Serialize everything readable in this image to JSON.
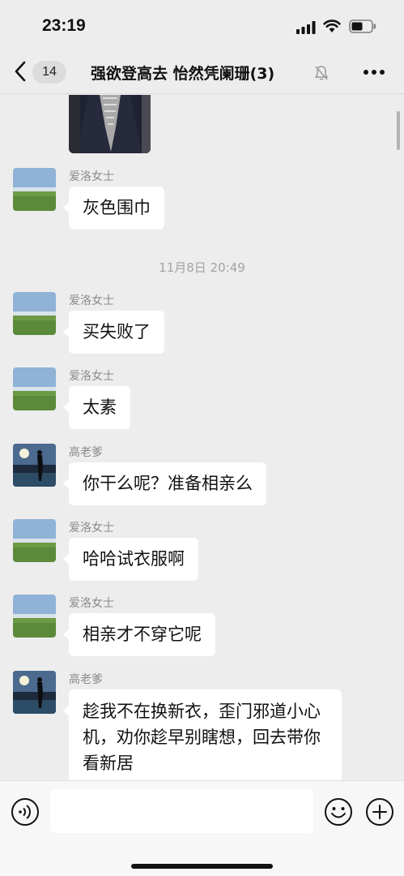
{
  "status_bar": {
    "time": "23:19"
  },
  "nav": {
    "unread_count": "14",
    "title": "强欲登高去 怡然凭阑珊(3)",
    "muted": true
  },
  "chat": {
    "time_divider": "11月8日 20:49",
    "messages": [
      {
        "sender": "爱洛女士",
        "avatar": "landscape-avatar",
        "text": "灰色围巾"
      },
      {
        "sender": "爱洛女士",
        "avatar": "landscape-avatar",
        "text": "买失败了"
      },
      {
        "sender": "爱洛女士",
        "avatar": "landscape-avatar",
        "text": "太素"
      },
      {
        "sender": "高老爹",
        "avatar": "silhouette-avatar",
        "text": "你干么呢？准备相亲么"
      },
      {
        "sender": "爱洛女士",
        "avatar": "landscape-avatar",
        "text": "哈哈试衣服啊"
      },
      {
        "sender": "爱洛女士",
        "avatar": "landscape-avatar",
        "text": "相亲才不穿它呢"
      },
      {
        "sender": "高老爹",
        "avatar": "silhouette-avatar",
        "text": "趁我不在换新衣，歪门邪道小心机，劝你趁早别瞎想，回去带你看新居"
      }
    ]
  },
  "input_bar": {
    "value": "",
    "placeholder": ""
  },
  "icons": {
    "back": "chevron-left-icon",
    "mute": "bell-slash-icon",
    "more": "more-dots-icon",
    "voice": "voice-icon",
    "emoji": "emoji-icon",
    "plus": "plus-icon"
  },
  "colors": {
    "background": "#ededed",
    "bubble": "#ffffff",
    "meta_text": "#8a8a8a"
  }
}
